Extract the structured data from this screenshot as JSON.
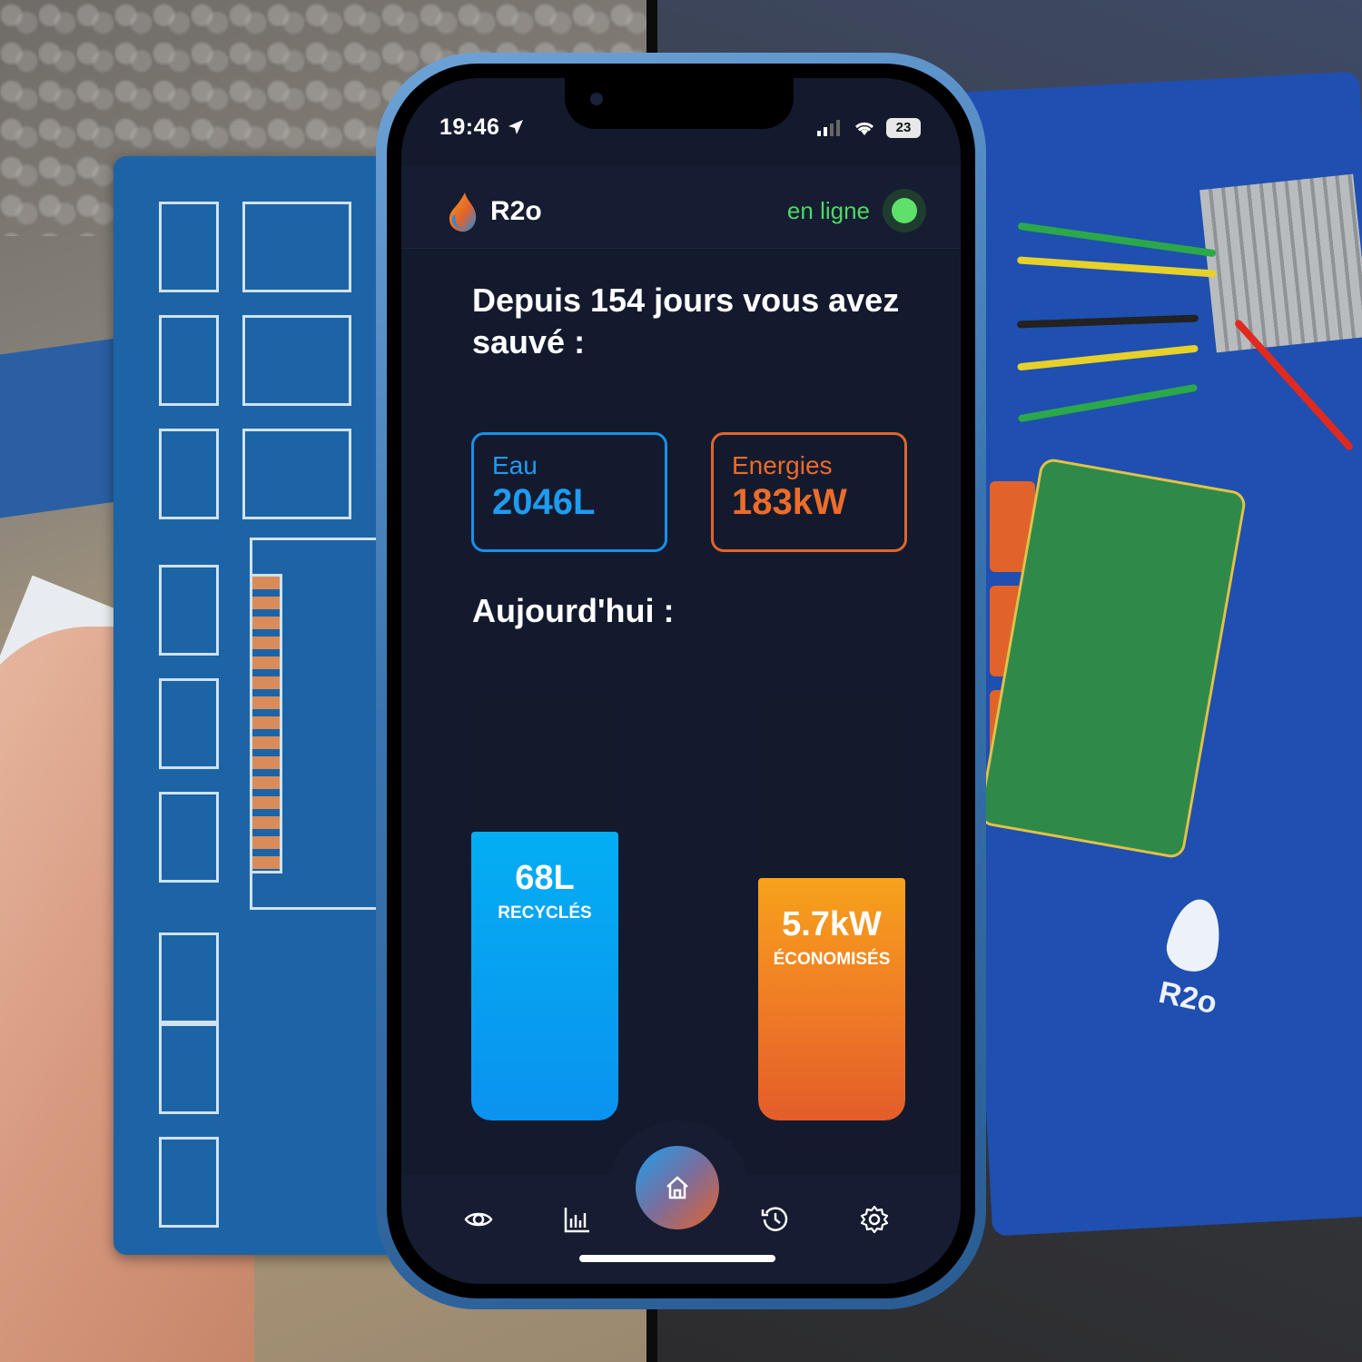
{
  "status_bar": {
    "time": "19:46",
    "battery": "23"
  },
  "app": {
    "title": "R2o",
    "connection_status": "en ligne"
  },
  "summary": {
    "headline": "Depuis 154 jours vous avez sauvé :"
  },
  "stats": {
    "water": {
      "label": "Eau",
      "value": "2046L",
      "color": "#1e9cf0"
    },
    "energy": {
      "label": "Energies",
      "value": "183kW",
      "color": "#ec6c2a"
    }
  },
  "today": {
    "heading": "Aujourd'hui :",
    "water": {
      "value": "68L",
      "caption": "RECYCLÉS",
      "fill_fraction": 0.68
    },
    "energy": {
      "value": "5.7kW",
      "caption": "ÉCONOMISÉS",
      "fill_fraction": 0.57
    }
  },
  "tabbar": {
    "items": [
      "eye-icon",
      "chart-icon",
      "home-icon",
      "history-icon",
      "gear-icon"
    ],
    "active": "home-icon"
  },
  "background": {
    "board_logo": "R2o"
  }
}
